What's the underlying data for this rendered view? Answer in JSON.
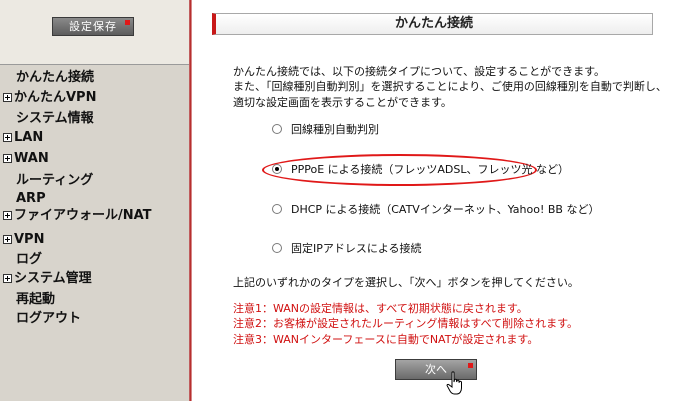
{
  "sidebar": {
    "save_button": "設定保存",
    "items": [
      {
        "label": "かんたん接続",
        "expandable": false
      },
      {
        "label": "かんたんVPN",
        "expandable": true
      },
      {
        "label": "システム情報",
        "expandable": false
      },
      {
        "label": "LAN",
        "expandable": true
      },
      {
        "label": "WAN",
        "expandable": true
      },
      {
        "label": "ルーティング",
        "expandable": false
      },
      {
        "label": "ARP",
        "expandable": false
      },
      {
        "label": "ファイアウォール/NAT",
        "expandable": true
      },
      {
        "label": "VPN",
        "expandable": true
      },
      {
        "label": "ログ",
        "expandable": false
      },
      {
        "label": "システム管理",
        "expandable": true
      },
      {
        "label": "再起動",
        "expandable": false
      },
      {
        "label": "ログアウト",
        "expandable": false
      }
    ]
  },
  "main": {
    "title": "かんたん接続",
    "intro": [
      "かんたん接続では、以下の接続タイプについて、設定することができます。",
      "また、「回線種別自動判別」を選択することにより、ご使用の回線種別を自動で判断し、",
      "適切な設定画面を表示することができます。"
    ],
    "options": [
      {
        "label": "回線種別自動判別",
        "selected": false
      },
      {
        "label": "PPPoE による接続（フレッツADSL、フレッツ光 など）",
        "selected": true
      },
      {
        "label": "DHCP による接続（CATVインターネット、Yahoo! BB など）",
        "selected": false
      },
      {
        "label": "固定IPアドレスによる接続",
        "selected": false
      }
    ],
    "instruction": "上記のいずれかのタイプを選択し、「次へ」ボタンを押してください。",
    "warnings": [
      "注意1：WANの設定情報は、すべて初期状態に戻されます。",
      "注意2：お客様が設定されたルーティング情報はすべて削除されます。",
      "注意3：WANインターフェースに自動でNATが設定されます。"
    ],
    "next_button": "次へ"
  },
  "colors": {
    "accent": "#c81818",
    "warning_text": "#d01010",
    "sidebar_bg": "#d8d4cc"
  }
}
